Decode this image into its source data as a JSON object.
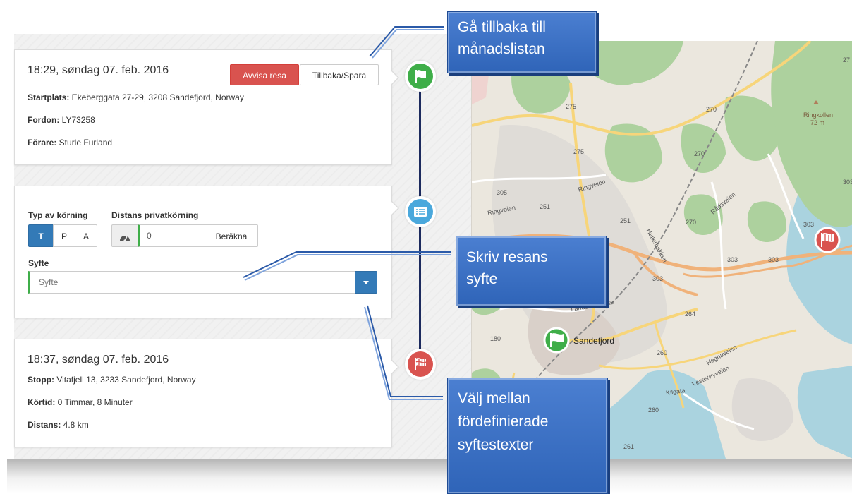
{
  "start_card": {
    "time": "18:29, søndag 07. feb. 2016",
    "reject_label": "Avvisa resa",
    "back_save_label": "Tillbaka/Spara",
    "startplats_label": "Startplats:",
    "startplats_value": " Ekeberggata 27-29, 3208 Sandefjord, Norway",
    "fordon_label": "Fordon:",
    "fordon_value": " LY73258",
    "forare_label": "Förare:",
    "forare_value": " Sturle Furland"
  },
  "form_card": {
    "type_label": "Typ av körning",
    "type_options": [
      "T",
      "P",
      "A"
    ],
    "type_selected": "T",
    "distance_label": "Distans privatkörning",
    "distance_value": "0",
    "calculate_label": "Beräkna",
    "purpose_label": "Syfte",
    "purpose_placeholder": "Syfte"
  },
  "stop_card": {
    "time": "18:37, søndag 07. feb. 2016",
    "stopp_label": "Stopp:",
    "stopp_value": " Vitafjell 13, 3233 Sandefjord, Norway",
    "kortid_label": "Körtid:",
    "kortid_value": " 0 Timmar, 8 Minuter",
    "distans_label": "Distans:",
    "distans_value": " 4.8 km"
  },
  "callouts": {
    "back": [
      "Gå tillbaka till",
      "månadslistan"
    ],
    "purpose": [
      "Skriv resans",
      "syfte"
    ],
    "choose": [
      "Välj mellan",
      "fördefinierade",
      "syftestexter"
    ]
  },
  "map": {
    "city_label": "Sandefjord",
    "hill_label": "Ringkollen",
    "hill_height": "72 m",
    "road_labels": [
      "275",
      "275",
      "270",
      "270",
      "270",
      "305",
      "251",
      "251",
      "303",
      "303",
      "303",
      "303",
      "264",
      "260",
      "180",
      "260",
      "261",
      "27",
      "303"
    ],
    "street_labels": [
      "Ringveien",
      "Ringveien",
      "Rådsveien",
      "Hallerbakken",
      "Landstads gate",
      "Vesterøyveien",
      "Kilgata",
      "Hegnaveien"
    ]
  },
  "colors": {
    "primary": "#337ab7",
    "danger": "#d9534f",
    "success_node": "#3fae49",
    "info_node": "#4aa8dc",
    "stop_node": "#d9534f",
    "timeline": "#1c2a5e",
    "callout": "#3a6fc4"
  },
  "icons": {
    "start_node": "flag-icon",
    "form_node": "list-icon",
    "stop_node": "checkered-flag-icon",
    "distance_addon": "speedometer-icon",
    "dropdown": "caret-down-icon"
  }
}
